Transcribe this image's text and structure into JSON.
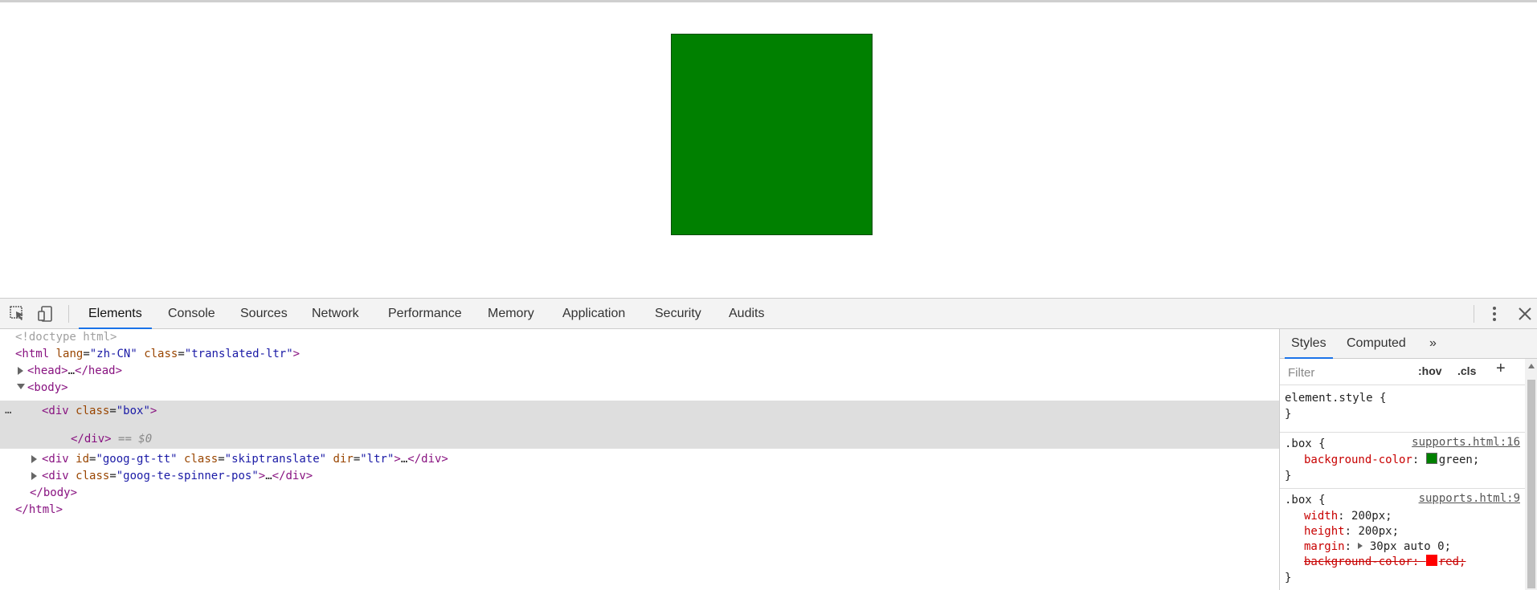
{
  "page": {
    "box_color": "#008000"
  },
  "devtools": {
    "tabs": [
      "Elements",
      "Console",
      "Sources",
      "Network",
      "Performance",
      "Memory",
      "Application",
      "Security",
      "Audits"
    ],
    "active_tab": "Elements",
    "icons": {
      "inspect": "inspect-icon",
      "device": "device-toggle-icon",
      "menu": "kebab-menu-icon",
      "close": "close-icon"
    }
  },
  "dom": {
    "doctype": "<!doctype html>",
    "html_open": {
      "tag": "<html",
      "attr1": "lang",
      "val1": "\"zh-CN\"",
      "attr2": "class",
      "val2": "\"translated-ltr\"",
      "end": ">"
    },
    "head": {
      "open": "<head>",
      "ellipsis": "…",
      "close": "</head>"
    },
    "body_open": "<body>",
    "selected_div": {
      "open": "<div",
      "attr": "class",
      "val": "\"box\"",
      "end": ">",
      "close": "</div>",
      "eq": "== $0"
    },
    "div2": {
      "open": "<div",
      "attr1": "id",
      "val1": "\"goog-gt-tt\"",
      "attr2": "class",
      "val2": "\"skiptranslate\"",
      "attr3": "dir",
      "val3": "\"ltr\"",
      "end": ">",
      "ellipsis": "…",
      "close": "</div>"
    },
    "div3": {
      "open": "<div",
      "attr": "class",
      "val": "\"goog-te-spinner-pos\"",
      "end": ">",
      "ellipsis": "…",
      "close": "</div>"
    },
    "body_close": "</body>",
    "html_close": "</html>",
    "dots": "…"
  },
  "styles": {
    "tabs": [
      "Styles",
      "Computed",
      "»"
    ],
    "filter_placeholder": "Filter",
    "hov": ":hov",
    "cls": ".cls",
    "plus": "+",
    "rules": [
      {
        "selector": "element.style {",
        "close": "}"
      },
      {
        "selector": ".box {",
        "source": "supports.html:16",
        "decls": [
          {
            "prop": "background-color",
            "value": "green;",
            "swatch": "#008000"
          }
        ],
        "close": "}"
      },
      {
        "selector": ".box {",
        "source": "supports.html:9",
        "decls": [
          {
            "prop": "width",
            "value": "200px;"
          },
          {
            "prop": "height",
            "value": "200px;"
          },
          {
            "prop": "margin",
            "value": "30px auto 0;"
          },
          {
            "prop": "background-color",
            "value": "red;",
            "swatch": "#ff0000",
            "struck": true
          }
        ],
        "close": "}"
      }
    ]
  }
}
